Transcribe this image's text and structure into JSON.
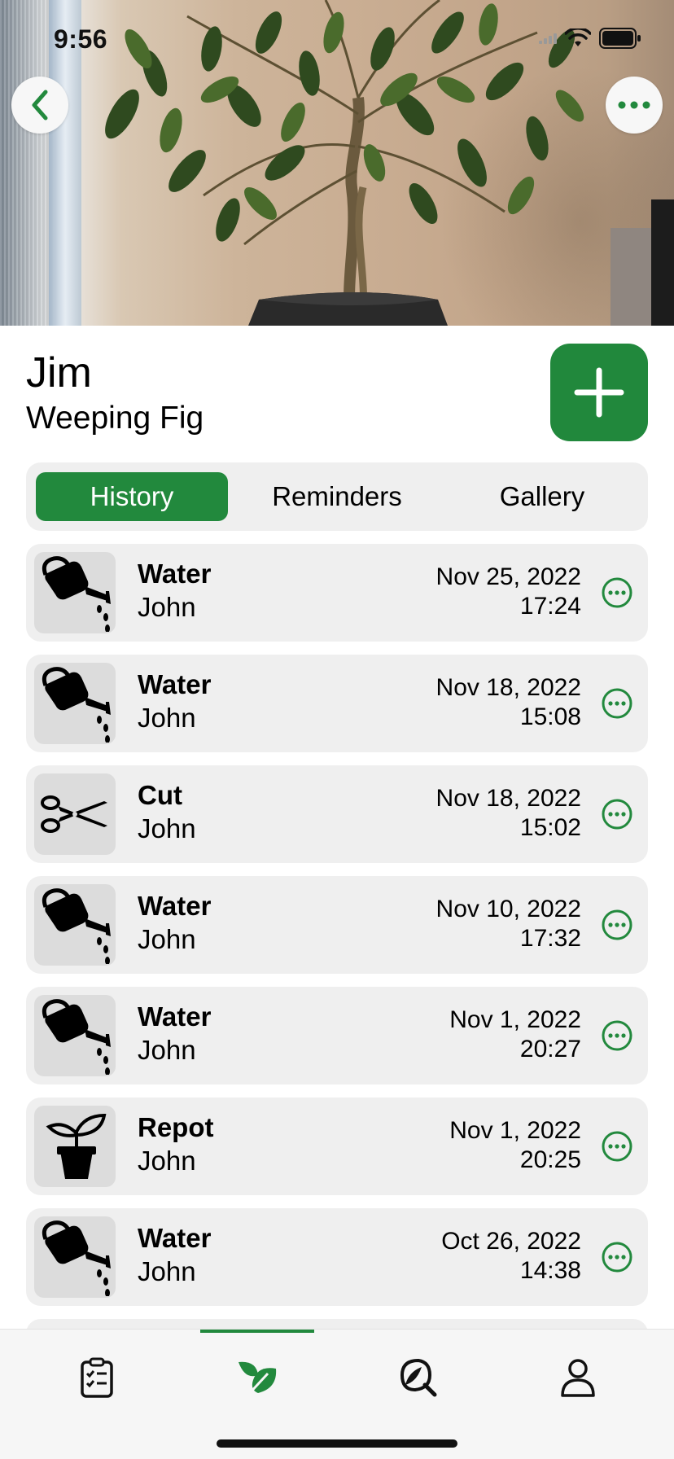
{
  "status_bar": {
    "time": "9:56"
  },
  "plant": {
    "name": "Jim",
    "species": "Weeping Fig"
  },
  "tabs": [
    {
      "label": "History",
      "active": true
    },
    {
      "label": "Reminders",
      "active": false
    },
    {
      "label": "Gallery",
      "active": false
    }
  ],
  "history": [
    {
      "action": "Water",
      "user": "John",
      "date": "Nov 25, 2022",
      "time": "17:24",
      "icon": "watering-can-icon"
    },
    {
      "action": "Water",
      "user": "John",
      "date": "Nov 18, 2022",
      "time": "15:08",
      "icon": "watering-can-icon"
    },
    {
      "action": "Cut",
      "user": "John",
      "date": "Nov 18, 2022",
      "time": "15:02",
      "icon": "scissors-icon"
    },
    {
      "action": "Water",
      "user": "John",
      "date": "Nov 10, 2022",
      "time": "17:32",
      "icon": "watering-can-icon"
    },
    {
      "action": "Water",
      "user": "John",
      "date": "Nov 1, 2022",
      "time": "20:27",
      "icon": "watering-can-icon"
    },
    {
      "action": "Repot",
      "user": "John",
      "date": "Nov 1, 2022",
      "time": "20:25",
      "icon": "plant-pot-icon"
    },
    {
      "action": "Water",
      "user": "John",
      "date": "Oct 26, 2022",
      "time": "14:38",
      "icon": "watering-can-icon"
    }
  ],
  "tab_bar": [
    {
      "icon": "clipboard-checklist-icon",
      "active": false
    },
    {
      "icon": "leaves-icon",
      "active": true
    },
    {
      "icon": "search-leaf-icon",
      "active": false
    },
    {
      "icon": "person-icon",
      "active": false
    }
  ],
  "colors": {
    "accent": "#22893d",
    "row_bg": "#efefef",
    "icon_box": "#dcdcdc"
  }
}
